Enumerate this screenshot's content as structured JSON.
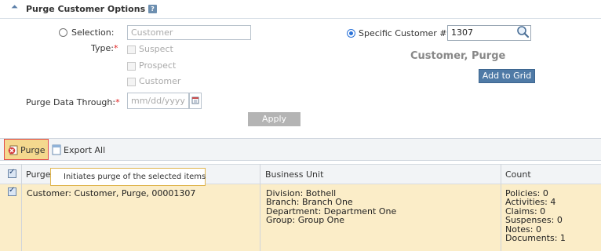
{
  "section": {
    "title": "Purge Customer Options",
    "help_glyph": "?"
  },
  "form": {
    "selection_label": "Selection:",
    "selection_placeholder": "Customer",
    "type_label": "Type:",
    "required_mark": "*",
    "type_options": [
      "Suspect",
      "Prospect",
      "Customer"
    ],
    "purge_data_through_label": "Purge Data Through:",
    "date_placeholder": "mm/dd/yyyy",
    "specific_customer_label": "Specific Customer #:",
    "specific_customer_value": "1307",
    "customer_name": "Customer, Purge",
    "add_to_grid_label": "Add to Grid",
    "apply_label": "Apply"
  },
  "toolbar": {
    "purge_label": "Purge",
    "export_all_label": "Export All"
  },
  "tooltip": {
    "text": "Initiates purge of the selected items"
  },
  "grid": {
    "columns": [
      "Purge",
      "Business Unit",
      "Count"
    ],
    "rows": [
      {
        "purge": "Customer: Customer, Purge, 00001307",
        "business_unit": [
          "Division: Bothell",
          "Branch: Branch One",
          "Department: Department One",
          "Group: Group One"
        ],
        "count": [
          "Policies: 0",
          "Activities: 4",
          "Claims: 0",
          "Suspenses: 0",
          "Notes: 0",
          "Documents: 1"
        ]
      }
    ]
  },
  "colors": {
    "row_highlight": "#fbedc8",
    "purge_button_bg": "#f4d88e",
    "purge_button_border": "#e24b4b",
    "add_to_grid_bg": "#4f7aa6"
  }
}
